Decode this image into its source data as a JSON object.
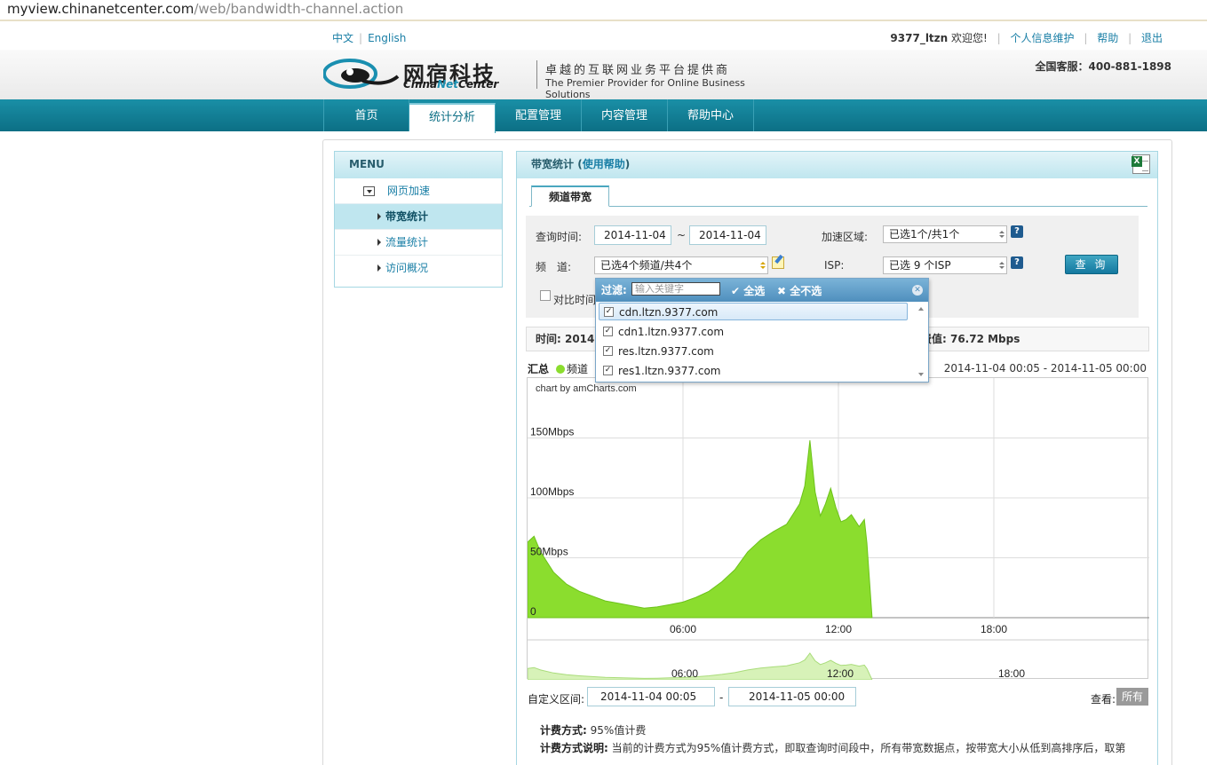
{
  "browser": {
    "url_host": "myview.chinanetcenter.com",
    "url_path": "/web/bandwidth-channel.action"
  },
  "topbar": {
    "lang_cn": "中文",
    "lang_en": "English",
    "username": "9377_ltzn",
    "welcome": "欢迎您!",
    "profile_link": "个人信息维护",
    "help_link": "帮助",
    "logout_link": "退出",
    "hotline": "全国客服：400-881-1898"
  },
  "logo": {
    "cn_name": "网宿科技",
    "en_name_1": "China",
    "en_name_2": "Net",
    "en_name_3": "Center",
    "slogan_cn": "卓越的互联网业务平台提供商",
    "slogan_en": "The Premier Provider for Online Business Solutions"
  },
  "nav": {
    "items": [
      "首页",
      "统计分析",
      "配置管理",
      "内容管理",
      "帮助中心"
    ],
    "active_index": 1
  },
  "menu": {
    "title": "MENU",
    "group": "网页加速",
    "items": [
      "带宽统计",
      "流量统计",
      "访问概况"
    ],
    "active_index": 0
  },
  "panel": {
    "title": "带宽统计",
    "help_link": "使用帮助",
    "tab": "频道带宽"
  },
  "filter": {
    "query_time_label": "查询时间:",
    "start_date": "2014-11-04",
    "range_sep": "~",
    "end_date": "2014-11-04",
    "region_label": "加速区域:",
    "region_value": "已选1个/共1个",
    "channel_label": "频　道:",
    "channel_value": "已选4个频道/共4个",
    "isp_label": "ISP:",
    "isp_value": "已选 9 个ISP",
    "query_button": "查 询",
    "compare_label": "对比时间",
    "help_icon": "?"
  },
  "summary": {
    "time_prefix": "时间: 2014-",
    "peak_suffix": "计费值: 76.72 Mbps"
  },
  "legend": {
    "total": "汇总",
    "series_partial": "频道"
  },
  "chart_range_text": "2014-11-04 00:05 - 2014-11-05 00:00",
  "chart_data": {
    "type": "area",
    "credit": "chart by amCharts.com",
    "ytick_labels": [
      "0",
      "50Mbps",
      "100Mbps",
      "150Mbps"
    ],
    "ytick_values": [
      0,
      50,
      100,
      150
    ],
    "xtick_labels": [
      "06:00",
      "12:00",
      "18:00"
    ],
    "xtick_hours": [
      6,
      12,
      18
    ],
    "x_unit": "hour",
    "xlim": [
      0,
      24
    ],
    "ylim": [
      0,
      200
    ],
    "grid": true,
    "color": "#8bdd2e",
    "series": [
      {
        "x": [
          0.0,
          0.25,
          0.5,
          1.0,
          1.5,
          2.0,
          2.5,
          3.0,
          3.5,
          4.0,
          4.5,
          5.0,
          5.5,
          6.0,
          6.5,
          7.0,
          7.5,
          8.0,
          8.5,
          9.0,
          9.5,
          10.0,
          10.3,
          10.5,
          10.7,
          10.9,
          11.1,
          11.3,
          11.5,
          11.7,
          11.9,
          12.1,
          12.3,
          12.5,
          12.8,
          13.0,
          13.1,
          13.3
        ],
        "y": [
          63,
          68,
          55,
          38,
          28,
          22,
          18,
          14,
          12,
          10,
          8,
          9,
          11,
          13,
          17,
          22,
          30,
          40,
          55,
          65,
          72,
          78,
          88,
          95,
          110,
          148,
          105,
          85,
          95,
          108,
          92,
          80,
          82,
          86,
          76,
          82,
          62,
          0
        ]
      }
    ]
  },
  "custom_range": {
    "label": "自定义区间:",
    "start": "2014-11-04 00:05",
    "sep": "-",
    "end": "2014-11-05 00:00"
  },
  "view": {
    "label": "查看:",
    "button": "所有"
  },
  "notes": {
    "billing_label": "计费方式:",
    "billing_value": "95%值计费",
    "explain_label": "计费方式说明:",
    "explain_value": "当前的计费方式为95%值计费方式，即取查询时间段中，所有带宽数据点，按带宽大小从低到高排序后，取第"
  },
  "dropdown": {
    "filter_label": "过滤:",
    "filter_placeholder": "输入关键字",
    "select_all": "全选",
    "select_none": "全不选",
    "options": [
      {
        "name": "cdn.ltzn.9377.com",
        "checked": true
      },
      {
        "name": "cdn1.ltzn.9377.com",
        "checked": true
      },
      {
        "name": "res.ltzn.9377.com",
        "checked": true
      },
      {
        "name": "res1.ltzn.9377.com",
        "checked": true
      }
    ]
  }
}
